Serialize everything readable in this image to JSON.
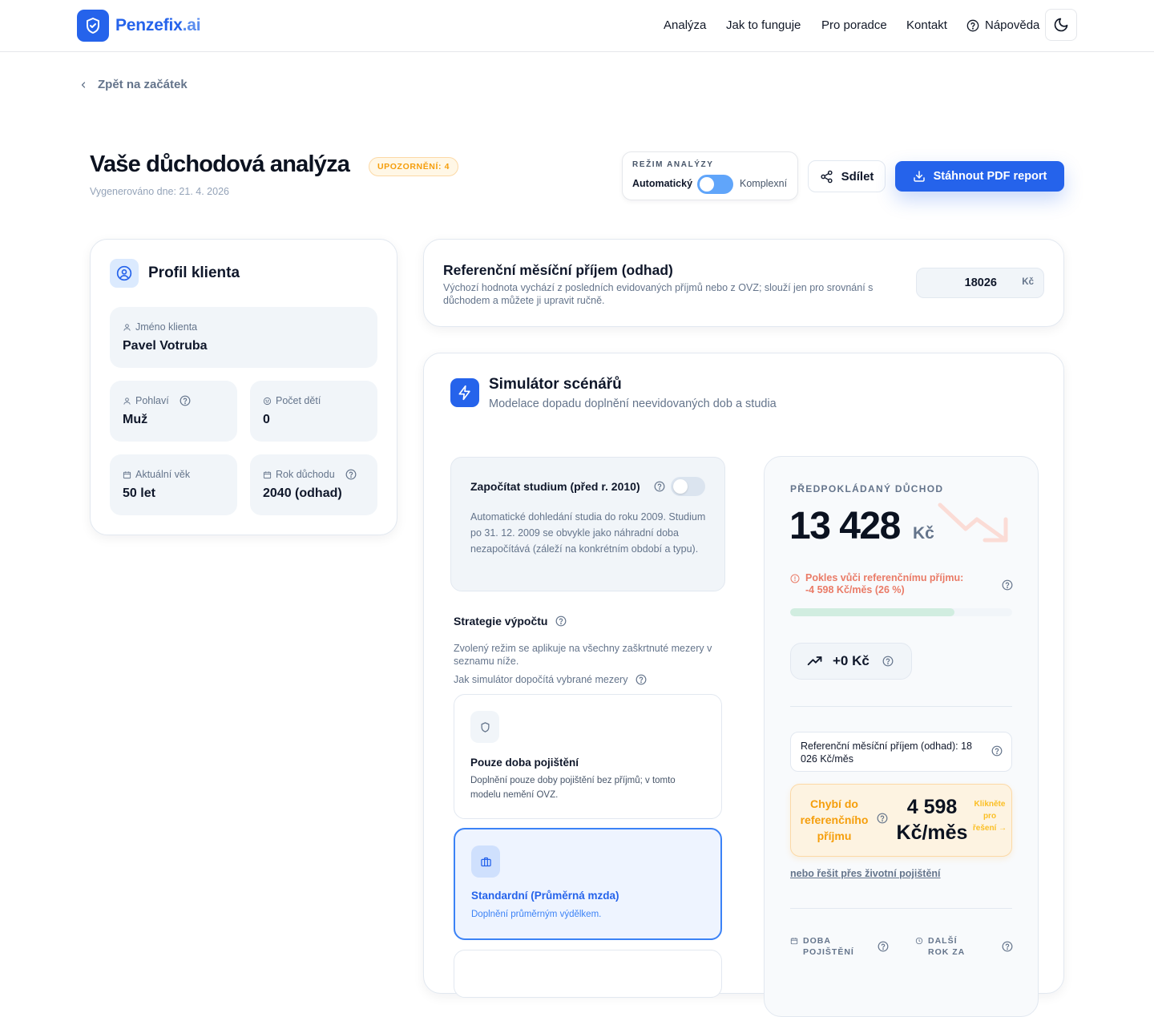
{
  "header": {
    "logo_main": "Penzefix",
    "logo_suffix": ".ai",
    "nav": [
      "Analýza",
      "Jak to funguje",
      "Pro poradce",
      "Kontakt"
    ],
    "help_label": "Nápověda"
  },
  "back_label": "Zpět na začátek",
  "page": {
    "title": "Vaše důchodová analýza",
    "warning_badge": "UPOZORNĚNÍ: 4",
    "generated": "Vygenerováno dne: 21. 4. 2026"
  },
  "mode": {
    "label": "REŽIM ANALÝZY",
    "left": "Automatický",
    "right": "Komplexní"
  },
  "actions": {
    "share": "Sdílet",
    "pdf": "Stáhnout PDF report"
  },
  "profile": {
    "title": "Profil klienta",
    "name_label": "Jméno klienta",
    "name_value": "Pavel Votruba",
    "gender_label": "Pohlaví",
    "gender_value": "Muž",
    "children_label": "Počet dětí",
    "children_value": "0",
    "age_label": "Aktuální věk",
    "age_value": "50 let",
    "retire_label": "Rok důchodu",
    "retire_value": "2040 (odhad)"
  },
  "reference": {
    "title": "Referenční měsíční příjem (odhad)",
    "description": "Výchozí hodnota vychází z posledních evidovaných příjmů nebo z OVZ; slouží jen pro srovnání s důchodem a můžete ji upravit ručně.",
    "value": "18026",
    "currency": "Kč"
  },
  "simulator": {
    "title": "Simulátor scénářů",
    "subtitle": "Modelace dopadu doplnění neevidovaných dob a studia",
    "study_title": "Započítat studium (před r. 2010)",
    "study_desc": "Automatické dohledání studia do roku 2009. Studium po 31. 12. 2009 se obvykle jako náhradní doba nezapočítává (záleží na konkrétním období a typu).",
    "study_enabled": false,
    "strategy_title": "Strategie výpočtu",
    "strategy_desc": "Zvolený režim se aplikuje na všechny zaškrtnuté mezery v seznamu níže.",
    "strategy_how": "Jak simulátor dopočítá vybrané mezery",
    "options": [
      {
        "title": "Pouze doba pojištění",
        "desc": "Doplnění pouze doby pojištění bez příjmů; v tomto modelu nemění OVZ.",
        "selected": false
      },
      {
        "title": "Standardní (Průměrná mzda)",
        "desc": "Doplnění průměrným výdělkem.",
        "selected": true
      }
    ]
  },
  "pension": {
    "label": "PŘEDPOKLÁDANÝ DŮCHOD",
    "amount": "13 428",
    "currency": "Kč",
    "drop_text": "Pokles vůči referenčnímu příjmu: -4 598 Kč/měs (26 %)",
    "bar_fraction": 0.74,
    "delta": "+0 Kč",
    "ref_text": "Referenční měsíční příjem (odhad): 18 026 Kč/měs",
    "gap_label": "Chybí do referenčního příjmu",
    "gap_amount": "4 598 Kč/měs",
    "gap_cta": "Klikněte pro řešení →",
    "insurance_link": "nebo řešit přes životní pojištění",
    "footer_left": "DOBA POJIŠTĚNÍ",
    "footer_right": "DALŠÍ ROK ZA"
  },
  "colors": {
    "brand": "#2563eb",
    "warning": "#f59e0b",
    "drop": "#ea7b67"
  }
}
